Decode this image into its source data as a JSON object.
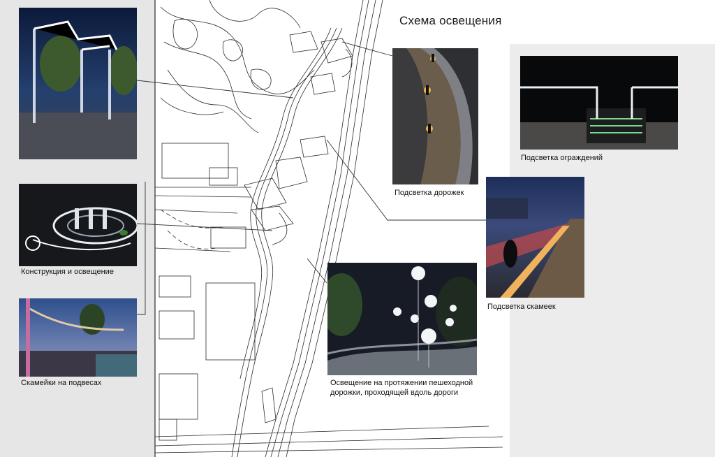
{
  "title": "Схема освещения",
  "captions": {
    "structure": "Конструкция и освещение",
    "swing_benches": "Скамейки на подвесах",
    "paths": "Подсветка дорожек",
    "railings": "Подсветка ограждений",
    "benches": "Подсветка скамеек",
    "walkway_line1": "Освещение на протяжении пешеходной",
    "walkway_line2": "дорожки, проходящей вдоль дороги"
  },
  "colors": {
    "left_panel": "#e6e6e6",
    "right_panel": "#ececec",
    "map_line": "#2a2a2a",
    "night_sky": "#1b2a4a"
  }
}
